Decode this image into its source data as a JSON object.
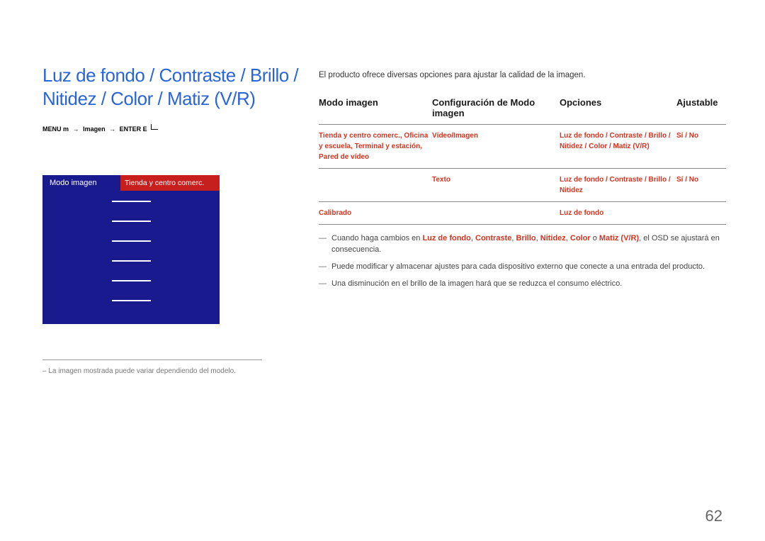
{
  "title": "Luz de fondo / Contraste / Brillo / Nitidez / Color / Matiz (V/R)",
  "menu_path": {
    "menu": "MENU",
    "m_icon": "m",
    "arrow": "→",
    "item": "Imagen",
    "enter": "ENTER E"
  },
  "menu_box": {
    "label1": "Modo imagen",
    "label2": "Tienda y centro comerc."
  },
  "left_footer_hr": true,
  "left_footnote": "– La imagen mostrada puede variar dependiendo del modelo.",
  "intro": "El producto ofrece diversas opciones para ajustar la calidad de la imagen.",
  "table": {
    "headers": {
      "mode": "Modo imagen",
      "config": "Configuración de Modo imagen",
      "options": "Opciones",
      "adj": "Ajustable"
    },
    "rows": [
      {
        "mode": "Tienda y centro comerc., Oficina y escuela, Terminal y estación, Pared de vídeo",
        "config": "Vídeo/Imagen",
        "options": "Luz de fondo / Contraste / Brillo / Nitidez / Color / Matiz (V/R)",
        "adj": "Sí / No"
      },
      {
        "mode": " ",
        "config": "Texto",
        "options": "Luz de fondo / Contraste / Brillo / Nitidez",
        "adj": "Sí / No"
      },
      {
        "mode": "Calibrado",
        "config": " ",
        "options": "Luz de fondo",
        "adj": " "
      }
    ]
  },
  "notes": [
    {
      "pre": "Cuando haga cambios en ",
      "r1": "Luz de fondo",
      "mid1": ", ",
      "r2": "Contraste",
      "mid2": ", ",
      "r3": "Brillo",
      "mid3": ", ",
      "r4": "Nitidez",
      "mid4": ", ",
      "r5": "Color",
      "mid5": " o ",
      "r6": "Matiz (V/R)",
      "tail": ", el OSD se ajustará en consecuencia."
    },
    {
      "text": "Puede modificar y almacenar ajustes para cada dispositivo externo que conecte a una entrada del producto."
    },
    {
      "text": "Una disminución en el brillo de la imagen hará que se reduzca el consumo eléctrico."
    }
  ],
  "page_number": "62"
}
